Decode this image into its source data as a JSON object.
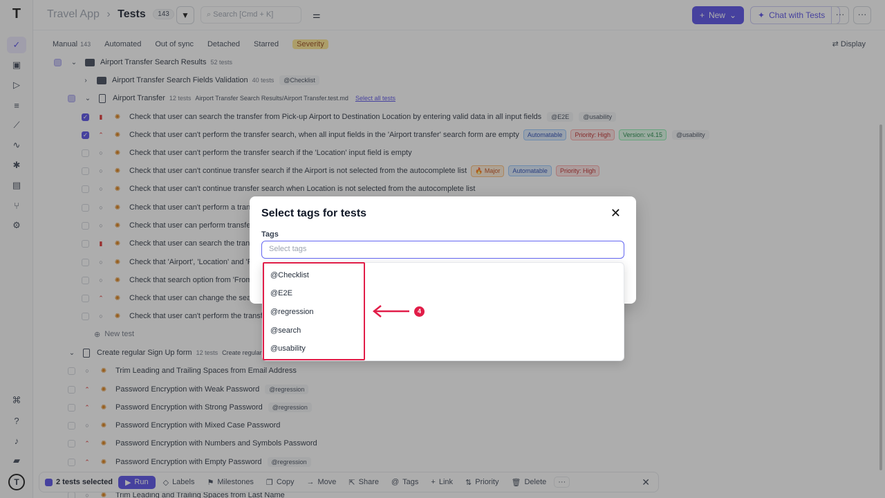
{
  "header": {
    "app_name": "Travel App",
    "separator": "›",
    "page_title": "Tests",
    "tests_count": "143",
    "search_placeholder": "Search [Cmd + K]",
    "new_label": "New",
    "chat_label": "Chat with Tests",
    "more_label": "···"
  },
  "tabs": [
    {
      "label": "Manual",
      "count": "143"
    },
    {
      "label": "Automated"
    },
    {
      "label": "Out of sync"
    },
    {
      "label": "Detached"
    },
    {
      "label": "Starred"
    },
    {
      "label": "Severity"
    }
  ],
  "display_label": "Display",
  "suites": {
    "s1": {
      "name": "Airport Transfer Search Results",
      "count": "52 tests"
    },
    "s2": {
      "name": "Airport Transfer Search Fields Validation",
      "count": "40 tests",
      "tag": "@Checklist"
    },
    "s3": {
      "name": "Airport Transfer",
      "count": "12 tests",
      "path": "Airport Transfer Search Results/Airport Transfer.test.md",
      "select_all": "Select all tests"
    },
    "s4": {
      "name": "Create regular Sign Up form",
      "count": "12 tests",
      "path": "Create regular"
    }
  },
  "tests": [
    {
      "title": "Check that user can search the transfer from Pick-up Airport to Destination Location by entering valid data in all input fields",
      "tags": [
        "@E2E",
        "@usability"
      ]
    },
    {
      "title": "Check that user can't perform the transfer search, when all input fields in the 'Airport transfer' search form are empty",
      "badges": [
        "Automatable",
        "Priority: High",
        "Version: v4.15"
      ],
      "tags": [
        "@usability"
      ]
    },
    {
      "title": "Check that user can't perform the transfer search if the 'Location' input field is empty"
    },
    {
      "title": "Check that user can't continue transfer search if the Airport is not selected from the autocomplete list",
      "badges": [
        "🔥 Major",
        "Automatable",
        "Priority: High"
      ]
    },
    {
      "title": "Check that user can't continue transfer search when Location is not selected from the autocomplete list"
    },
    {
      "title": "Check that user can't perform a trans"
    },
    {
      "title": "Check that user can perform transfer"
    },
    {
      "title": "Check that user can search the transf"
    },
    {
      "title": "Check that 'Airport', 'Location' and 'Pi"
    },
    {
      "title": "Check that search option from 'From a"
    },
    {
      "title": "Check that user can change the searc"
    },
    {
      "title": "Check that user can't perform the transfe"
    }
  ],
  "new_test_label": "New test",
  "signup_tests": [
    {
      "title": "Trim Leading and Trailing Spaces from Email Address"
    },
    {
      "title": "Password Encryption with Weak Password",
      "tag": "@regression"
    },
    {
      "title": "Password Encryption with Strong Password",
      "tag": "@regression"
    },
    {
      "title": "Password Encryption with Mixed Case Password"
    },
    {
      "title": "Password Encryption with Numbers and Symbols Password"
    },
    {
      "title": "Password Encryption with Empty Password",
      "tag": "@regression"
    },
    {
      "title": "Trim Leading and Trailing Spaces from Last Name"
    }
  ],
  "modal": {
    "title": "Select tags for tests",
    "label": "Tags",
    "placeholder": "Select tags",
    "options": [
      "@Checklist",
      "@E2E",
      "@regression",
      "@search",
      "@usability"
    ],
    "step_number": "4"
  },
  "bottom_bar": {
    "selected": "2 tests selected",
    "run": "Run",
    "labels": "Labels",
    "milestones": "Milestones",
    "copy": "Copy",
    "move": "Move",
    "share": "Share",
    "tags": "Tags",
    "link": "Link",
    "priority": "Priority",
    "delete": "Delete",
    "more": "···"
  },
  "colors": {
    "accent": "#4f46e5",
    "highlight": "#e11d48"
  }
}
